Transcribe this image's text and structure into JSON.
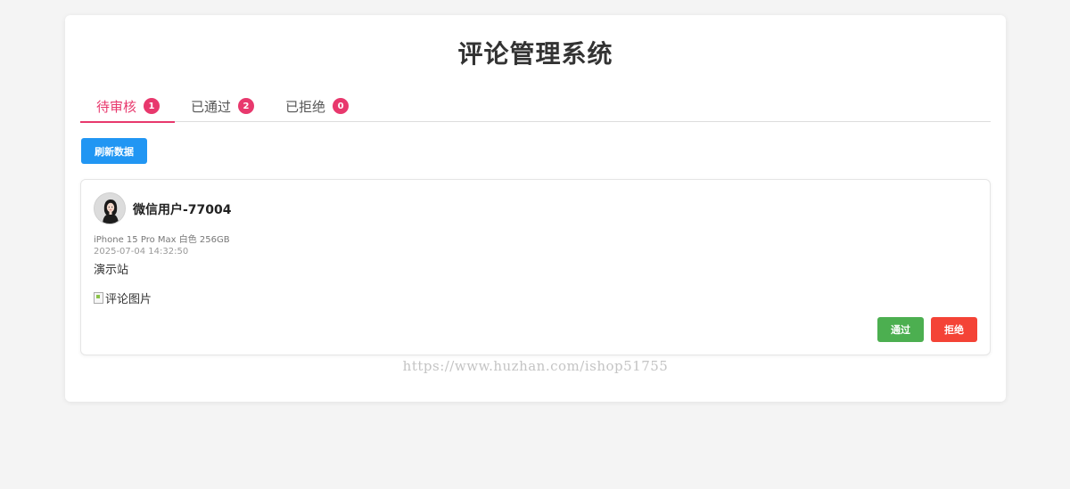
{
  "page_title": "评论管理系统",
  "tabs": [
    {
      "label": "待审核",
      "count": "1",
      "active": true
    },
    {
      "label": "已通过",
      "count": "2",
      "active": false
    },
    {
      "label": "已拒绝",
      "count": "0",
      "active": false
    }
  ],
  "toolbar": {
    "refresh_label": "刷新数据"
  },
  "comment": {
    "username": "微信用户-77004",
    "product": "iPhone 15 Pro Max 白色 256GB",
    "time": "2025-07-04 14:32:50",
    "content": "演示站",
    "image_alt": "评论图片",
    "approve_label": "通过",
    "reject_label": "拒绝"
  },
  "watermark": "https://www.huzhan.com/ishop51755",
  "colors": {
    "accent": "#e8386d",
    "primary": "#2196f3",
    "approve": "#4caf50",
    "reject": "#f44336"
  },
  "icons": {
    "avatar": "user-avatar",
    "broken_image": "broken-image-icon"
  }
}
